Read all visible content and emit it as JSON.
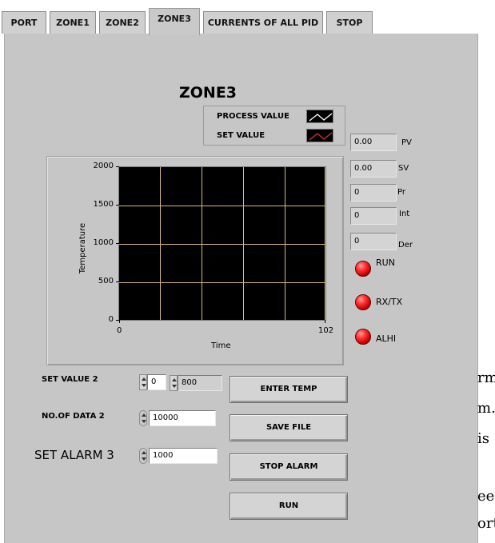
{
  "tabs": [
    {
      "label": "PORT"
    },
    {
      "label": "ZONE1"
    },
    {
      "label": "ZONE2"
    },
    {
      "label": "ZONE3"
    },
    {
      "label": "CURRENTS OF ALL PID"
    },
    {
      "label": "STOP"
    }
  ],
  "active_tab": "ZONE3",
  "zone": {
    "title": "ZONE3"
  },
  "legend": [
    {
      "label": "PROCESS VALUE",
      "color": "#ffffff"
    },
    {
      "label": "SET VALUE",
      "color": "#cc3333"
    }
  ],
  "chart_data": {
    "type": "line",
    "title": "",
    "xlabel": "Time",
    "ylabel": "Temperature",
    "xlim": [
      0,
      102
    ],
    "ylim": [
      0,
      2000
    ],
    "yticks": [
      "2000",
      "1500",
      "1000",
      "500",
      "0"
    ],
    "xticks": [
      "0",
      "102"
    ],
    "grid": true,
    "series": [
      {
        "name": "PROCESS VALUE",
        "values": []
      },
      {
        "name": "SET VALUE",
        "values": []
      }
    ]
  },
  "indicators": [
    {
      "value": "0.00",
      "label": "PV"
    },
    {
      "value": "0.00",
      "label": "SV"
    },
    {
      "value": "0",
      "label": "Pr"
    },
    {
      "value": "0",
      "label": "Int"
    },
    {
      "value": "0",
      "label": "Der"
    }
  ],
  "leds": [
    {
      "label": "RUN",
      "color": "#e01010"
    },
    {
      "label": "RX/TX",
      "color": "#e01010"
    },
    {
      "label": "ALHI",
      "color": "#e01010"
    }
  ],
  "controls": {
    "set_value_2": {
      "label": "SET VALUE 2",
      "value_a": "0",
      "value_b": "800"
    },
    "no_of_data_2": {
      "label": "NO.OF DATA 2",
      "value": "10000"
    },
    "set_alarm_3": {
      "label": "SET ALARM 3",
      "value": "1000"
    }
  },
  "buttons": {
    "enter_temp": "ENTER TEMP",
    "save_file": "SAVE FILE",
    "stop_alarm": "STOP ALARM",
    "run": "RUN"
  },
  "background_text": [
    "rm",
    "m.",
    "is",
    "ee",
    "ort"
  ]
}
